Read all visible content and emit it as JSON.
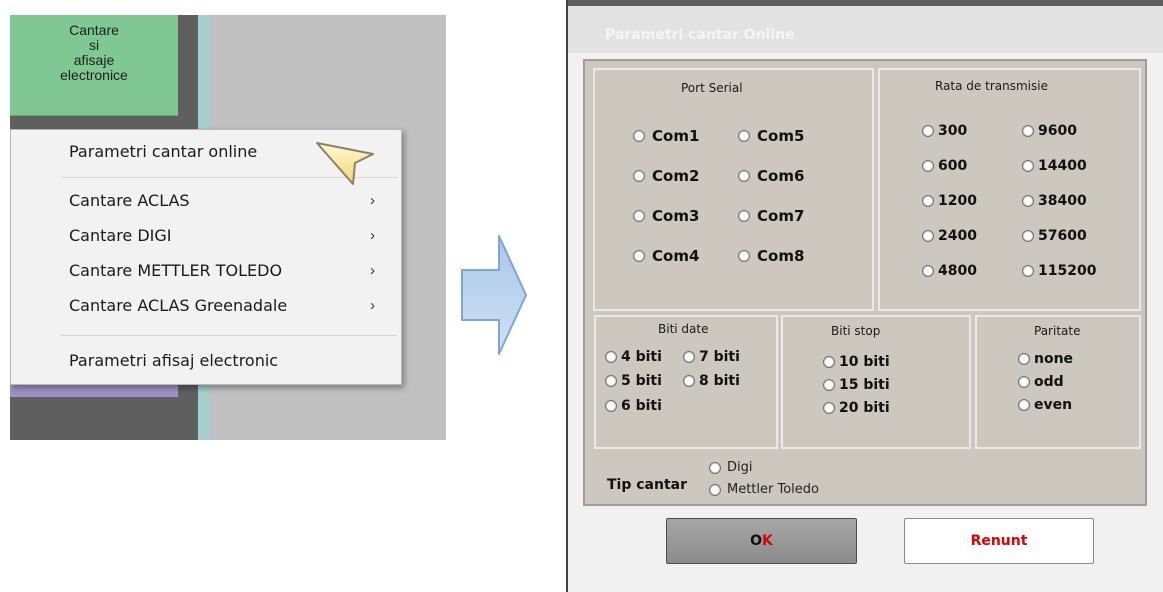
{
  "left_menu": {
    "cantare_button_label": "Cantare\nsi\nafisaje\nelectronice",
    "items": [
      {
        "label": "Parametri cantar online",
        "has_submenu": false
      },
      {
        "label": "Cantare ACLAS",
        "has_submenu": true
      },
      {
        "label": "Cantare DIGI",
        "has_submenu": true
      },
      {
        "label": "Cantare METTLER TOLEDO",
        "has_submenu": true
      },
      {
        "label": "Cantare ACLAS Greenadale",
        "has_submenu": true
      },
      {
        "label": "Parametri afisaj electronic",
        "has_submenu": false
      }
    ],
    "submenu_arrow": "›",
    "cursor_icon": "pointer-cursor-icon"
  },
  "arrow_icon": "right-arrow-icon",
  "dialog": {
    "title": "Parametri cantar Online",
    "port_serial": {
      "title": "Port Serial",
      "options": [
        "Com1",
        "Com5",
        "Com2",
        "Com6",
        "Com3",
        "Com7",
        "Com4",
        "Com8"
      ]
    },
    "rata": {
      "title": "Rata de transmisie",
      "options": [
        "300",
        "9600",
        "600",
        "14400",
        "1200",
        "38400",
        "2400",
        "57600",
        "4800",
        "115200"
      ]
    },
    "biti_date": {
      "title": "Biti date",
      "options": [
        "4 biti",
        "7 biti",
        "5 biti",
        "8 biti",
        "6 biti"
      ]
    },
    "biti_stop": {
      "title": "Biti stop",
      "options": [
        "10 biti",
        "15 biti",
        "20 biti"
      ]
    },
    "paritate": {
      "title": "Paritate",
      "options": [
        "none",
        "odd",
        "even"
      ]
    },
    "tip_cantar": {
      "label": "Tip cantar",
      "options": [
        "Digi",
        "Mettler Toledo"
      ]
    },
    "ok_label": "OK",
    "ok_letters": [
      "O",
      "K"
    ],
    "renunt_label": "Renunt",
    "colors": {
      "menu_button_green": "#7fc793",
      "panel_background": "#cdc8bf",
      "ok_k_color": "#dc0000",
      "renunt_color": "#dc0000"
    }
  }
}
